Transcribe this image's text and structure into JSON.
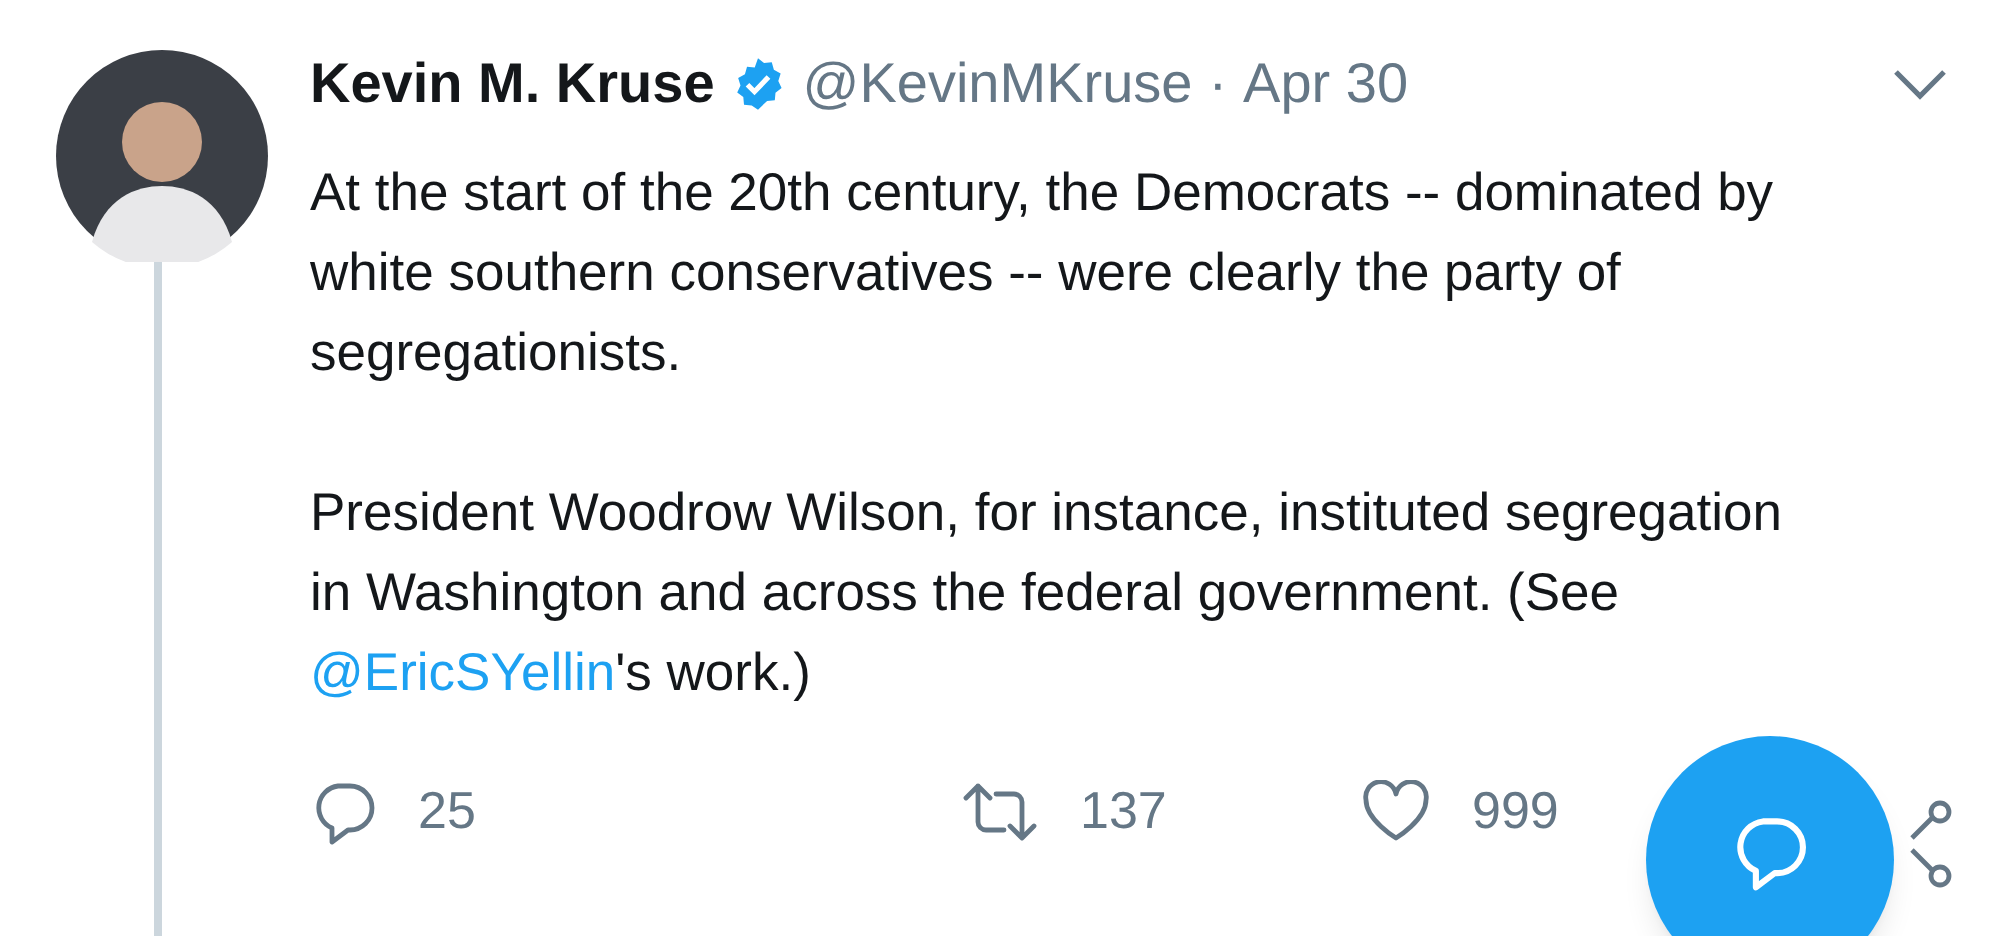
{
  "author": {
    "name": "Kevin M. Kruse",
    "verified": true,
    "handle": "@KevinMKruse",
    "separator": "·",
    "date": "Apr 30"
  },
  "paragraphs": [
    {
      "text": "At the start of the 20th century, the Democrats -- dominated by white southern conservatives -- were clearly the party of segregationists."
    },
    {
      "text": "President Woodrow Wilson, for instance, instituted segregation in Washington and across the federal government. (See ",
      "mention": "@EricSYellin",
      "after": "'s work.)"
    }
  ],
  "actions": [
    {
      "kind": "reply",
      "count": "25"
    },
    {
      "kind": "retweet",
      "count": "137"
    },
    {
      "kind": "like",
      "count": "999"
    }
  ]
}
